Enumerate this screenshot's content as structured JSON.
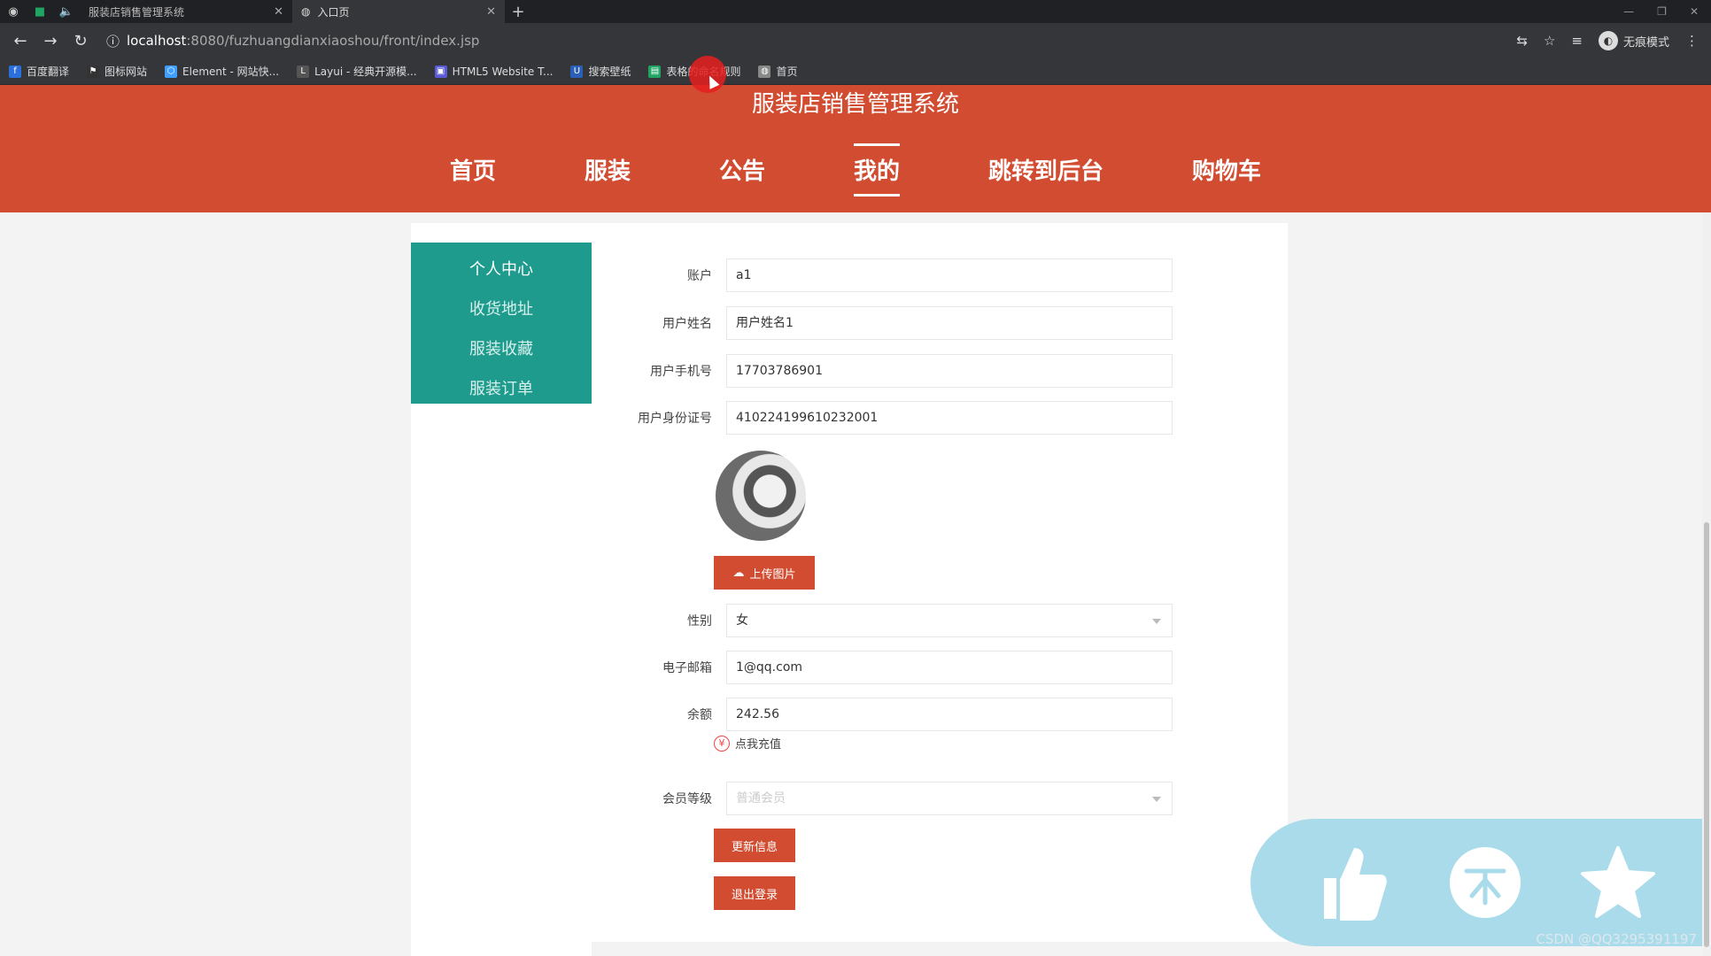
{
  "browser": {
    "tabs": [
      {
        "title": "服装店销售管理系统",
        "active": false
      },
      {
        "title": "入口页",
        "active": true
      }
    ],
    "url_host": "localhost",
    "url_path": ":8080/fuzhuangdianxiaoshou/front/index.jsp",
    "incognito_label": "无痕模式",
    "bookmarks": [
      {
        "label": "百度翻译",
        "icon_color": "#2a6fdb"
      },
      {
        "label": "图标网站",
        "icon_color": "#333333"
      },
      {
        "label": "Element - 网站快...",
        "icon_color": "#409eff"
      },
      {
        "label": "Layui - 经典开源模...",
        "icon_color": "#555555"
      },
      {
        "label": "HTML5 Website T...",
        "icon_color": "#5a5ad6"
      },
      {
        "label": "搜索壁纸",
        "icon_color": "#2b5fb8"
      },
      {
        "label": "表格的命名规则",
        "icon_color": "#1fa463"
      },
      {
        "label": "首页",
        "icon_color": "#888888"
      }
    ]
  },
  "site": {
    "title": "服装店销售管理系统",
    "nav": [
      {
        "label": "首页",
        "active": false
      },
      {
        "label": "服装",
        "active": false
      },
      {
        "label": "公告",
        "active": false
      },
      {
        "label": "我的",
        "active": true
      },
      {
        "label": "跳转到后台",
        "active": false
      },
      {
        "label": "购物车",
        "active": false
      }
    ],
    "accent": "#d24c31",
    "sidebar_color": "#1e9b8d"
  },
  "sidebar": {
    "items": [
      {
        "label": "个人中心"
      },
      {
        "label": "收货地址"
      },
      {
        "label": "服装收藏"
      },
      {
        "label": "服装订单"
      }
    ]
  },
  "form": {
    "account_label": "账户",
    "account_value": "a1",
    "name_label": "用户姓名",
    "name_value": "用户姓名1",
    "phone_label": "用户手机号",
    "phone_value": "17703786901",
    "idcard_label": "用户身份证号",
    "idcard_value": "410224199610232001",
    "upload_label": "上传图片",
    "gender_label": "性别",
    "gender_value": "女",
    "email_label": "电子邮箱",
    "email_value": "1@qq.com",
    "balance_label": "余额",
    "balance_value": "242.56",
    "recharge_label": "点我充值",
    "member_label": "会员等级",
    "member_value": "普通会员",
    "update_label": "更新信息",
    "logout_label": "退出登录"
  },
  "watermark": "CSDN @QQ3295391197"
}
